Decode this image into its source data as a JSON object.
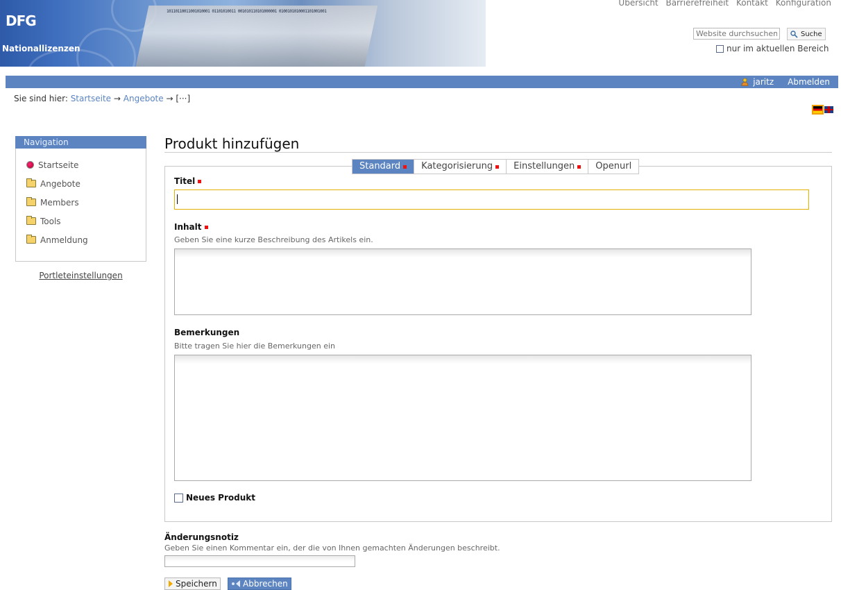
{
  "header": {
    "logo_text": "DFG",
    "brand": "Nationallizenzen",
    "banner_digits": "10110110011001010001 01101010011 001010110101000001 0100101010001101001001",
    "top_links": [
      "Übersicht",
      "Barrierefreiheit",
      "Kontakt",
      "Konfiguration"
    ],
    "search": {
      "placeholder": "Website durchsuchen",
      "button_label": "Suche",
      "scope_label": "nur im aktuellen Bereich"
    }
  },
  "userbar": {
    "username": "jaritz",
    "logout_label": "Abmelden"
  },
  "breadcrumb": {
    "prefix": "Sie sind hier:",
    "items": [
      "Startseite",
      "Angebote",
      "[···]"
    ],
    "separator": "→"
  },
  "languages": [
    "de-flag",
    "en-flag"
  ],
  "portlet": {
    "title": "Navigation",
    "items": [
      {
        "label": "Startseite",
        "icon": "home-icon"
      },
      {
        "label": "Angebote",
        "icon": "folder-icon"
      },
      {
        "label": "Members",
        "icon": "folder-icon"
      },
      {
        "label": "Tools",
        "icon": "folder-icon"
      },
      {
        "label": "Anmeldung",
        "icon": "folder-icon"
      }
    ],
    "settings_link": "Portleteinstellungen"
  },
  "main": {
    "title": "Produkt hinzufügen",
    "tabs": [
      {
        "label": "Standard",
        "required": true,
        "active": true
      },
      {
        "label": "Kategorisierung",
        "required": true,
        "active": false
      },
      {
        "label": "Einstellungen",
        "required": true,
        "active": false
      },
      {
        "label": "Openurl",
        "required": false,
        "active": false
      }
    ],
    "fields": {
      "title_label": "Titel",
      "title_value": "",
      "content_label": "Inhalt",
      "content_help": "Geben Sie eine kurze Beschreibung des Artikels ein.",
      "remarks_label": "Bemerkungen",
      "remarks_help": "Bitte tragen Sie hier die Bemerkungen ein",
      "new_product_label": "Neues Produkt"
    },
    "change_note": {
      "label": "Änderungsnotiz",
      "help": "Geben Sie einen Kommentar ein, der die von Ihnen gemachten Änderungen beschreibt."
    },
    "buttons": {
      "save": "Speichern",
      "cancel": "Abbrechen"
    }
  },
  "colors": {
    "accent": "#5b84c0",
    "required": "#e11111",
    "focus_border": "#e3b000"
  }
}
